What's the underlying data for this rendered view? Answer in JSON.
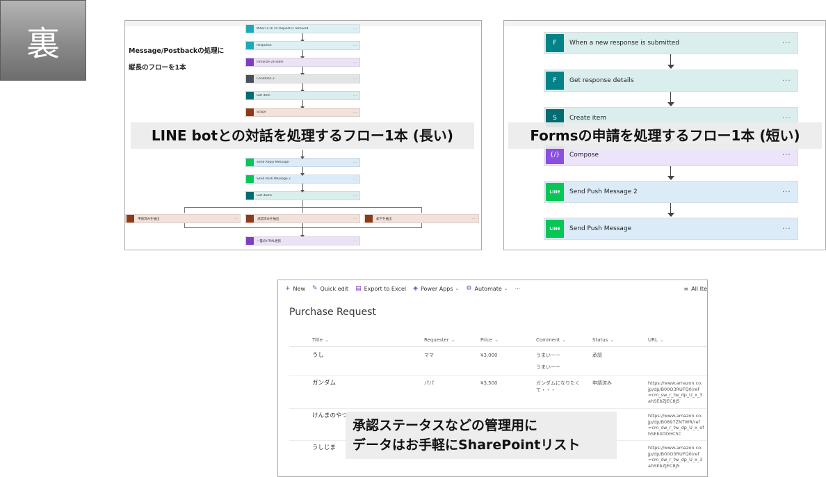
{
  "tag": "裏",
  "left_panel": {
    "note_line1": "Message/Postbackの処理に",
    "note_line2": "縦長のフローを1本",
    "steps": [
      {
        "label": "When a HTTP request is received",
        "icon": "http-request-icon",
        "color": "#1fa8b8",
        "bg": "#ddf0f3"
      },
      {
        "label": "Response",
        "icon": "response-icon",
        "color": "#1fa8b8",
        "bg": "#ddf0f3"
      },
      {
        "label": "Initialize variable",
        "icon": "variable-icon",
        "color": "#7c3fc4",
        "bg": "#ece2f6"
      },
      {
        "label": "Condition 2",
        "icon": "condition-icon",
        "color": "#484f58",
        "bg": "#e2e4e6"
      },
      {
        "label": "Get item",
        "icon": "sharepoint-icon",
        "color": "#036c70",
        "bg": "#dbeeee"
      },
      {
        "label": "Scope",
        "icon": "scope-icon",
        "color": "#8b3a1c",
        "bg": "#f2e2dc"
      }
    ],
    "steps_lower": [
      {
        "label": "Send Reply Message",
        "icon": "line-icon",
        "color": "#06c755",
        "bg": "#dcebf8"
      },
      {
        "label": "Send Push Message 2",
        "icon": "line-icon",
        "color": "#06c755",
        "bg": "#dcebf8"
      },
      {
        "label": "Get items",
        "icon": "sharepoint-icon",
        "color": "#036c70",
        "bg": "#dbeeee"
      }
    ],
    "branches": [
      {
        "label": "申請済みを抽出",
        "color": "#8b3a1c",
        "bg": "#f2e2dc"
      },
      {
        "label": "承認済みを抽出",
        "color": "#8b3a1c",
        "bg": "#f2e2dc"
      },
      {
        "label": "却下を抽出",
        "color": "#8b3a1c",
        "bg": "#f2e2dc"
      }
    ],
    "final": {
      "label": "一覧のHTML更新",
      "icon": "compose-icon",
      "color": "#7c3fc4",
      "bg": "#ece2f6"
    }
  },
  "right_panel": {
    "steps": [
      {
        "label": "When a new response is submitted",
        "icon": "forms-icon",
        "color": "#038387",
        "bg": "#dbeeee"
      },
      {
        "label": "Get response details",
        "icon": "forms-icon",
        "color": "#038387",
        "bg": "#dbeeee"
      },
      {
        "label": "Create item",
        "icon": "sharepoint-icon",
        "color": "#036c70",
        "bg": "#dbeeee"
      },
      {
        "label": "Compose",
        "icon": "compose-icon",
        "color": "#8a4fe0",
        "bg": "#ece4fa"
      },
      {
        "label": "Send Push Message 2",
        "icon": "line-icon",
        "color": "#06c755",
        "bg": "#dcebf8"
      },
      {
        "label": "Send Push Message",
        "icon": "line-icon",
        "color": "#06c755",
        "bg": "#dcebf8"
      }
    ]
  },
  "captions": {
    "left": "LINE botとの対話を処理するフロー1本 (長い)",
    "right": "Formsの申請を処理するフロー1本 (短い)",
    "bottom_line1": "承認ステータスなどの管理用に",
    "bottom_line2": "データはお手軽にSharePointリスト"
  },
  "sharepoint": {
    "commands": {
      "new": "New",
      "quick_edit": "Quick edit",
      "export": "Export to Excel",
      "power_apps": "Power Apps",
      "automate": "Automate",
      "more": "···",
      "view": "All Ite"
    },
    "title": "Purchase Request",
    "columns": {
      "title": "Title",
      "requester": "Requester",
      "price": "Price",
      "comment": "Comment",
      "status": "Status",
      "url": "URL"
    },
    "rows": [
      {
        "title": "うし",
        "requester": "ママ",
        "price": "¥3,000",
        "comment": "うまいーー",
        "comment2": "うまいーー",
        "status": "承認",
        "url": ""
      },
      {
        "title": "ガンダム",
        "requester": "パパ",
        "price": "¥3,500",
        "comment": "ガンダムになりたく",
        "comment2": "て・・・",
        "status": "申請済み",
        "url": "https://www.amazon.co.\njp/dp/B00O3RUFQ0/ref\n=cm_sw_r_tw_dp_U_x_3\nahSEbZJEC8J5"
      },
      {
        "title": "けんまのやつ",
        "requester": "",
        "price": "",
        "comment": "",
        "comment2": "",
        "status": "",
        "url": "https://www.amazon.co.\njp/dp/B0897ZNTWR/ref\n=cm_sw_r_tw_dp_U_x_ef\nhSEbX0DHC5C"
      },
      {
        "title": "うしじま",
        "requester": "",
        "price": "",
        "comment": "",
        "comment2": "",
        "status": "",
        "url": "https://www.amazon.co.\njp/dp/B00O3RUFQ0/ref\n=cm_sw_r_tw_dp_U_x_3\nahSEbZJEC8J5"
      }
    ]
  }
}
